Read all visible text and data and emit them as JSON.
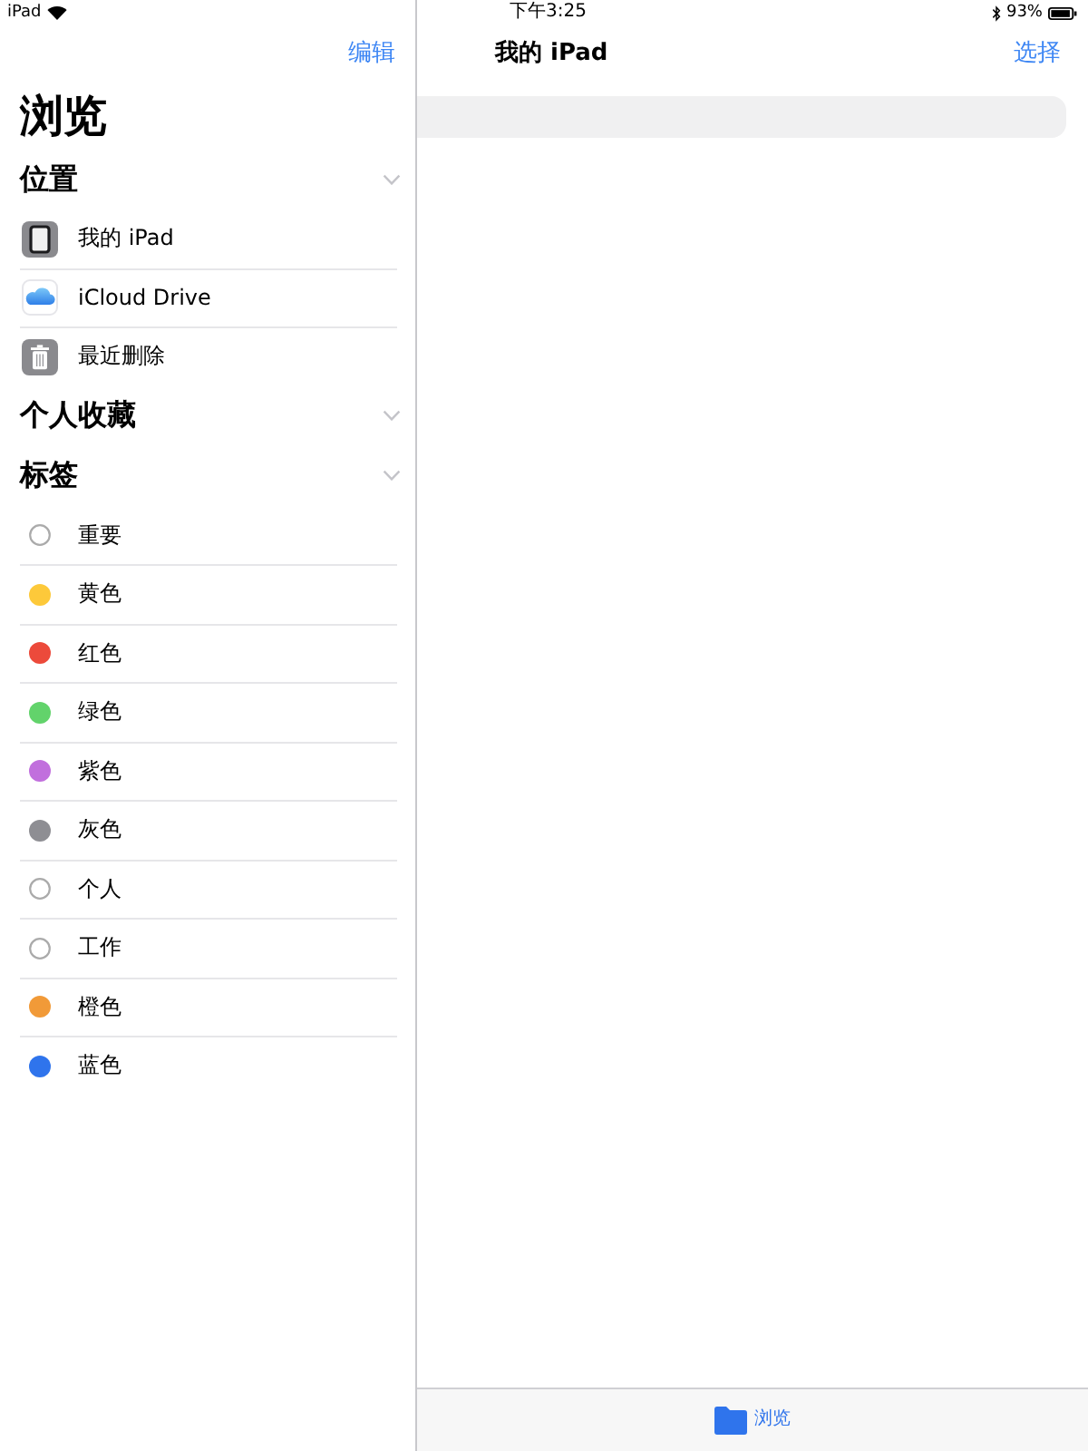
{
  "status_bar": {
    "device": "iPad",
    "time": "下午3:25",
    "battery": "93%"
  },
  "sidebar": {
    "edit_button": "编辑",
    "title": "浏览",
    "locations": {
      "title": "位置",
      "items": [
        {
          "label": "我的 iPad",
          "kind": "ipad"
        },
        {
          "label": "iCloud Drive",
          "kind": "icloud"
        },
        {
          "label": "最近删除",
          "kind": "trash"
        }
      ]
    },
    "favorites": {
      "title": "个人收藏"
    },
    "tags": {
      "title": "标签",
      "items": [
        {
          "label": "重要",
          "kind": "empty"
        },
        {
          "label": "黄色",
          "kind": "filled",
          "color": "#fdc93a"
        },
        {
          "label": "红色",
          "kind": "filled",
          "color": "#ec4a3b"
        },
        {
          "label": "绿色",
          "kind": "filled",
          "color": "#62d36b"
        },
        {
          "label": "紫色",
          "kind": "filled",
          "color": "#c16fdd"
        },
        {
          "label": "灰色",
          "kind": "filled",
          "color": "#8e8e93"
        },
        {
          "label": "个人",
          "kind": "empty"
        },
        {
          "label": "工作",
          "kind": "empty"
        },
        {
          "label": "橙色",
          "kind": "filled",
          "color": "#f19a38"
        },
        {
          "label": "蓝色",
          "kind": "filled",
          "color": "#2f74ec"
        }
      ]
    }
  },
  "main": {
    "title": "我的 iPad",
    "select_button": "选择",
    "tab_bar": {
      "tabs": [
        {
          "label": "浏览",
          "selected": true
        }
      ]
    }
  }
}
